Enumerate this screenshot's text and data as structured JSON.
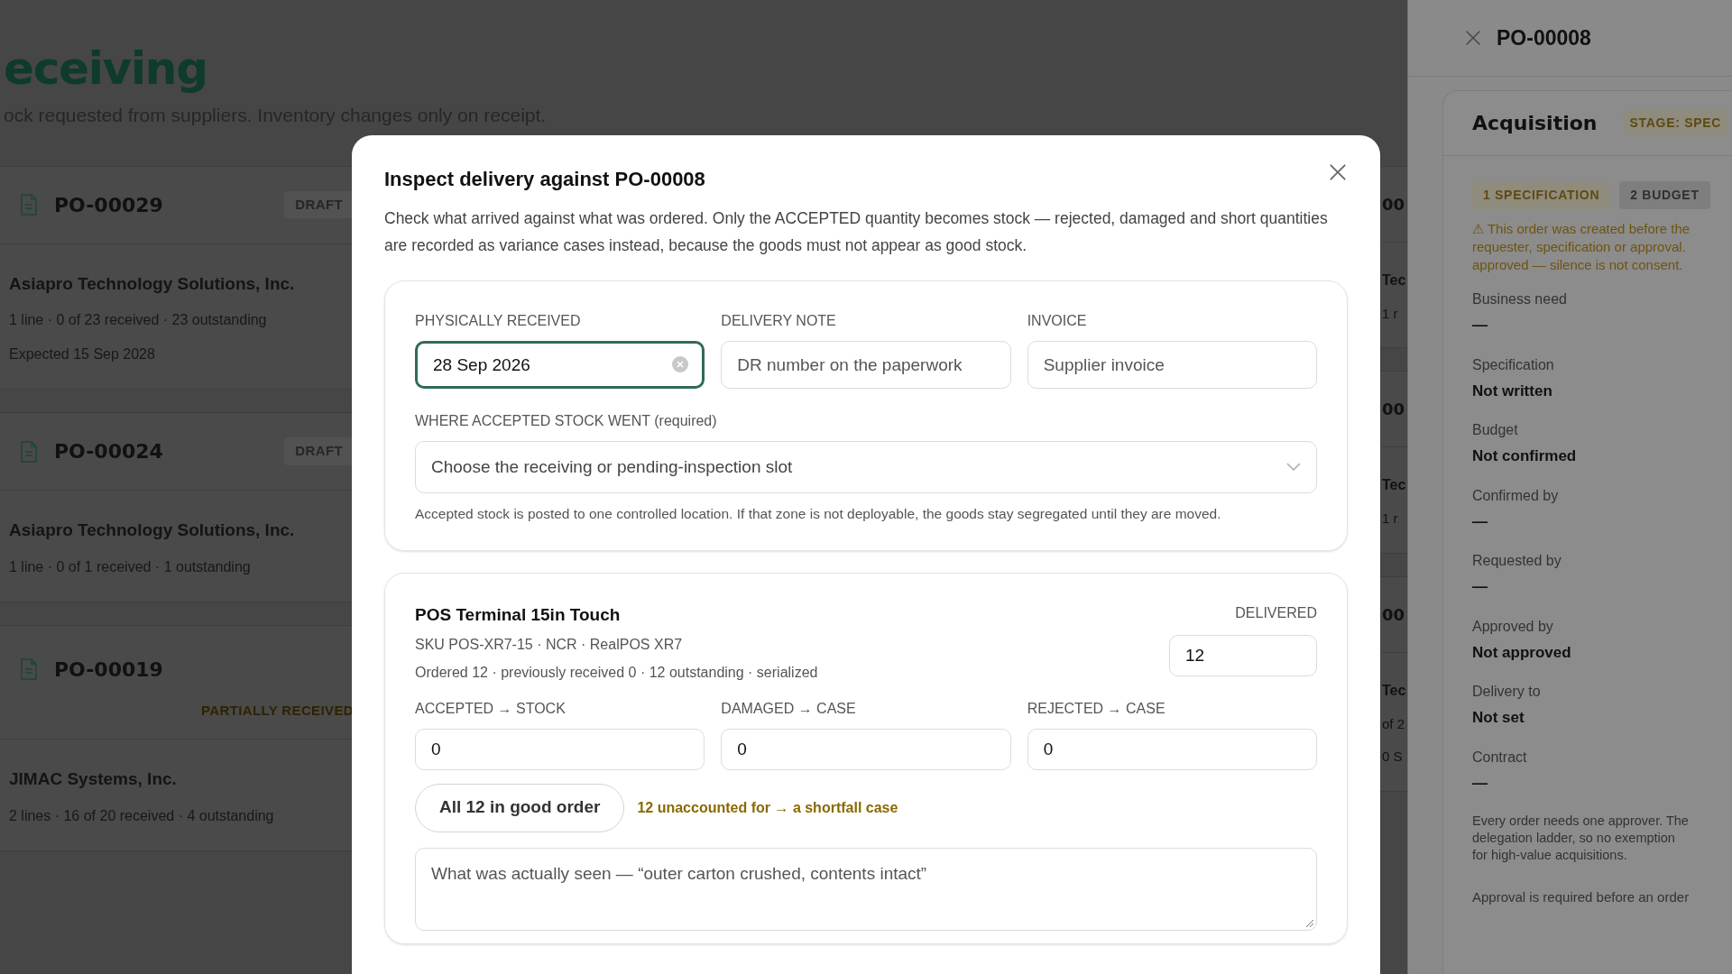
{
  "page": {
    "title": "eceiving",
    "subtitle": "ock requested from suppliers. Inventory changes only on receipt."
  },
  "orders": [
    {
      "number": "PO-00029",
      "status": "DRAFT",
      "kind": "draft",
      "supplier": "Asiapro Technology Solutions, Inc.",
      "summary": "1 line · 0 of 23 received · 23 outstanding",
      "expected": "Expected 15 Sep 2028"
    },
    {
      "number": "PO-00024",
      "status": "DRAFT",
      "kind": "draft",
      "supplier": "Asiapro Technology Solutions, Inc.",
      "summary": "1 line · 0 of 1 received · 1 outstanding"
    },
    {
      "number": "PO-00019",
      "status": "PARTIALLY RECEIVED",
      "kind": "partial",
      "supplier": "JIMAC Systems, Inc.",
      "summary": "2 lines · 16 of 20 received · 4 outstanding"
    }
  ],
  "column_2": [
    {
      "heading": "00",
      "line_1": "Tec",
      "line_2": "1 r"
    },
    {
      "heading": "00",
      "line_1": "Tec",
      "line_2": "1 r"
    },
    {
      "heading": "00",
      "line_1": "Tec",
      "line_2": "of 2",
      "line_3": "0 S"
    }
  ],
  "drawer": {
    "title": "PO-00008",
    "card_title": "Acquisition",
    "stage": "STAGE: SPEC",
    "steps": [
      {
        "label": "1 SPECIFICATION",
        "selected": true
      },
      {
        "label": "2 BUDGET",
        "selected": false
      }
    ],
    "warning": [
      "⚠ This order was created before the",
      "requester, specification or approval.",
      "approved — silence is not consent."
    ],
    "fields": [
      {
        "label": "Business need",
        "value": "—"
      },
      {
        "label": "Specification",
        "value": "Not written"
      },
      {
        "label": "Budget",
        "value": "Not confirmed"
      },
      {
        "label": "Confirmed by",
        "value": "—"
      },
      {
        "label": "Requested by",
        "value": "—"
      },
      {
        "label": "Approved by",
        "value": "Not approved"
      },
      {
        "label": "Delivery to",
        "value": "Not set"
      },
      {
        "label": "Contract",
        "value": "—"
      }
    ],
    "note": [
      "Every order needs one approver. The",
      "delegation ladder, so no exemption",
      "for high-value acquisitions."
    ],
    "footer": "Approval is required before an order"
  },
  "dialog": {
    "title": "Inspect delivery against PO-00008",
    "description": "Check what arrived against what was ordered. Only the ACCEPTED quantity becomes stock — rejected, damaged and short quantities are recorded as variance cases instead, because the goods must not appear as good stock.",
    "receipt_fields": [
      {
        "label": "PHYSICALLY RECEIVED",
        "value": "28 Sep 2026",
        "focused": true,
        "clearable": true
      },
      {
        "label": "DELIVERY NOTE",
        "placeholder": "DR number on the paperwork",
        "focused": false,
        "clearable": false
      },
      {
        "label": "INVOICE",
        "placeholder": "Supplier invoice",
        "focused": false,
        "clearable": false
      }
    ],
    "location": {
      "label": "WHERE ACCEPTED STOCK WENT (required)",
      "placeholder": "Choose the receiving or pending-inspection slot",
      "help": "Accepted stock is posted to one controlled location. If that zone is not deployable, the goods stay segregated until they are moved."
    },
    "line": {
      "name": "POS Terminal 15in Touch",
      "sku": "SKU POS-XR7-15 · NCR · RealPOS XR7",
      "ordered": "Ordered 12 · previously received 0 · 12 outstanding · serialized",
      "delivered_label": "DELIVERED",
      "delivered": "12",
      "quantities": [
        {
          "label": "ACCEPTED → STOCK",
          "value": "0"
        },
        {
          "label": "DAMAGED → CASE",
          "value": "0"
        },
        {
          "label": "REJECTED → CASE",
          "value": "0"
        }
      ],
      "all_good_button": "All 12 in good order",
      "variance": "12 unaccounted for → a shortfall case",
      "observation_placeholder": "What was actually seen — “outer carton crushed, contents intact”"
    }
  }
}
